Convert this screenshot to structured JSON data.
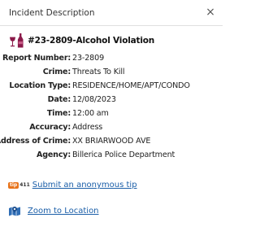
{
  "header": {
    "title": "Incident Description",
    "close_glyph": "×"
  },
  "incident": {
    "icon": "alcohol-bottle-glass-icon",
    "title": "#23-2809-Alcohol Violation"
  },
  "details": [
    {
      "label": "Report Number:",
      "value": "23-2809"
    },
    {
      "label": "Crime:",
      "value": "Threats To Kill"
    },
    {
      "label": "Location Type:",
      "value": "RESIDENCE/HOME/APT/CONDO"
    },
    {
      "label": "Date:",
      "value": "12/08/2023"
    },
    {
      "label": "Time:",
      "value": "12:00 am"
    },
    {
      "label": "Accuracy:",
      "value": "Address"
    },
    {
      "label": "Address of Crime:",
      "value": "XX BRIARWOOD AVE"
    },
    {
      "label": "Agency:",
      "value": "Billerica Police Department"
    }
  ],
  "actions": {
    "tip_badge_left": "tip",
    "tip_badge_right": "411",
    "tip_link": "Submit an anonymous tip",
    "zoom_link": "Zoom to Location"
  },
  "colors": {
    "link": "#1a5ea8",
    "tip_badge": "#e8741c",
    "bottle": "#8b1a4a",
    "map_icon": "#2f6db5"
  }
}
